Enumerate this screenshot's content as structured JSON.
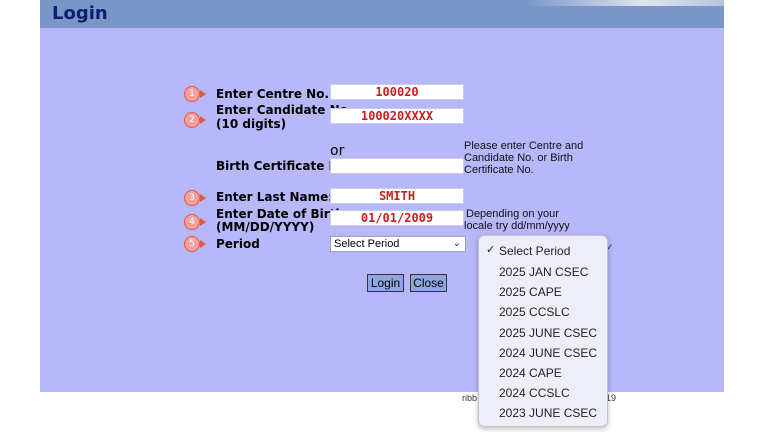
{
  "header": {
    "title": "Login"
  },
  "form": {
    "steps": [
      "1",
      "2",
      "3",
      "4",
      "5"
    ],
    "centre_label": "Enter Centre No.",
    "centre_value": "100020",
    "candidate_label_1": "Enter Candidate No.",
    "candidate_label_2": "(10 digits)",
    "candidate_value": "100020XXXX",
    "or_text": "or",
    "birth_label": "Birth Certificate No.",
    "birth_value": "",
    "help_1": "Please enter Centre and",
    "help_2": "Candidate No. or Birth",
    "help_3": "Certificate No.",
    "lastname_label": "Enter Last Name:",
    "lastname_value": "SMITH",
    "dob_label_1": "Enter Date of Birth",
    "dob_label_2": "(MM/DD/YYYY)",
    "dob_value": "01/01/2009",
    "dob_help_1": "Depending on your",
    "dob_help_2": "locale try dd/mm/yyyy",
    "period_label": "Period",
    "period_selected": "Select Period"
  },
  "buttons": {
    "login": "Login",
    "close": "Close"
  },
  "footer": {
    "left": "ribb",
    "right": "19"
  },
  "dropdown": {
    "checked_index": 0,
    "check_mark": "✓",
    "options": [
      "Select Period",
      "2025 JAN CSEC",
      "2025 CAPE",
      "2025 CCSLC",
      "2025 JUNE CSEC",
      "2024 JUNE CSEC",
      "2024 CAPE",
      "2024 CCSLC",
      "2023 JUNE CSEC"
    ]
  },
  "colors": {
    "accent": "#e05b3a",
    "field_text": "#c81e1e",
    "background": "#b7b7fa",
    "header": "#7a95c8"
  }
}
